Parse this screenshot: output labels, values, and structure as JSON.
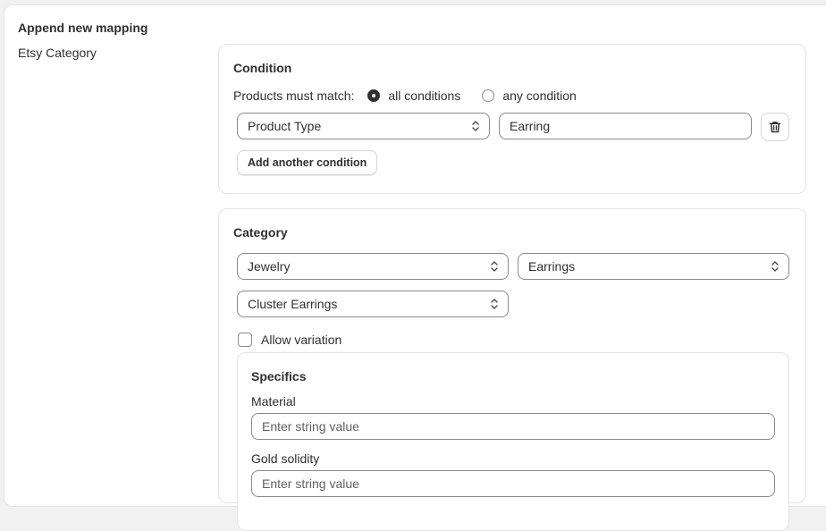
{
  "page": {
    "title": "Append new mapping",
    "side_label": "Etsy Category"
  },
  "condition": {
    "heading": "Condition",
    "match_label": "Products must match:",
    "options": [
      {
        "label": "all conditions",
        "selected": true
      },
      {
        "label": "any condition",
        "selected": false
      }
    ],
    "rule": {
      "field": "Product Type",
      "value": "Earring"
    },
    "add_button": "Add another condition"
  },
  "category": {
    "heading": "Category",
    "level1": "Jewelry",
    "level2": "Earrings",
    "level3": "Cluster Earrings",
    "allow_variation_label": "Allow variation",
    "allow_variation_checked": false,
    "specifics": {
      "heading": "Specifics",
      "fields": [
        {
          "label": "Material",
          "placeholder": "Enter string value"
        },
        {
          "label": "Gold solidity",
          "placeholder": "Enter string value"
        }
      ]
    }
  },
  "icons": {
    "delete": "trash-icon",
    "select": "chevron-up-down-icon"
  }
}
